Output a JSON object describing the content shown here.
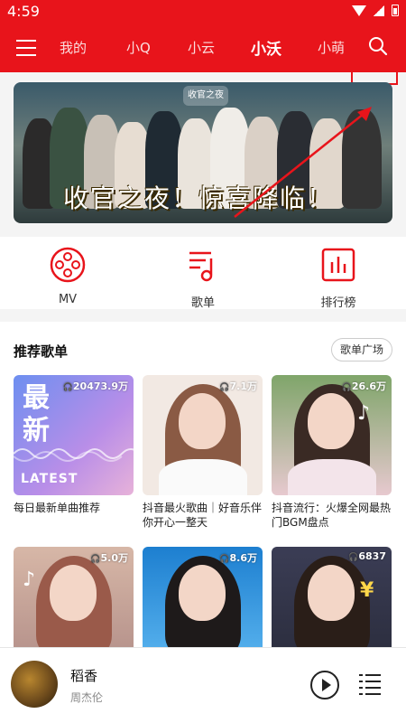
{
  "status_bar": {
    "time": "4:59"
  },
  "header": {
    "tabs": [
      {
        "label": "我的"
      },
      {
        "label": "小Q"
      },
      {
        "label": "小云"
      },
      {
        "label": "小沃"
      },
      {
        "label": "小萌"
      }
    ],
    "active_tab": "小沃",
    "accent_color": "#e8141b"
  },
  "banner": {
    "logo_text": "收官之夜",
    "caption": "收官之夜！惊喜降临！"
  },
  "shortcuts": [
    {
      "label": "MV",
      "icon": "film-reel-icon"
    },
    {
      "label": "歌单",
      "icon": "playlist-note-icon"
    },
    {
      "label": "排行榜",
      "icon": "bar-chart-icon"
    }
  ],
  "recommend": {
    "title": "推荐歌单",
    "more_label": "歌单广场",
    "cards": [
      {
        "title": "每日最新单曲推荐",
        "count": "20473.9万",
        "cover_text": "最\n新",
        "cover_en": "LATEST"
      },
      {
        "title": "抖音最火歌曲｜好音乐伴你开心一整天",
        "count": "7.1万"
      },
      {
        "title": "抖音流行：火爆全网最热门BGM盘点",
        "count": "26.6万"
      },
      {
        "title": "",
        "count": "5.0万"
      },
      {
        "title": "",
        "count": "8.6万"
      },
      {
        "title": "",
        "count": "6837"
      }
    ]
  },
  "player": {
    "song": "稻香",
    "artist": "周杰伦"
  }
}
